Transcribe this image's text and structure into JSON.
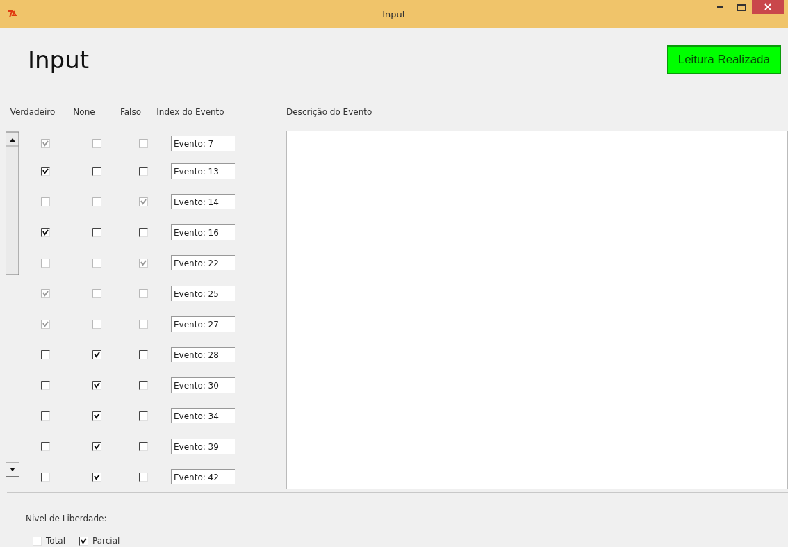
{
  "window": {
    "title": "Input"
  },
  "header": {
    "title": "Input",
    "status_button": "Leitura Realizada"
  },
  "table": {
    "columns": [
      "Verdadeiro",
      "None",
      "Falso",
      "Index do Evento",
      "Descrição do Evento"
    ],
    "rows": [
      {
        "verdadeiro": true,
        "none": false,
        "falso": false,
        "disabled": true,
        "index": "Evento: 7"
      },
      {
        "verdadeiro": true,
        "none": false,
        "falso": false,
        "disabled": false,
        "index": "Evento: 13"
      },
      {
        "verdadeiro": false,
        "none": false,
        "falso": true,
        "disabled": true,
        "index": "Evento: 14"
      },
      {
        "verdadeiro": true,
        "none": false,
        "falso": false,
        "disabled": false,
        "index": "Evento: 16"
      },
      {
        "verdadeiro": false,
        "none": false,
        "falso": true,
        "disabled": true,
        "index": "Evento: 22"
      },
      {
        "verdadeiro": true,
        "none": false,
        "falso": false,
        "disabled": true,
        "index": "Evento: 25"
      },
      {
        "verdadeiro": true,
        "none": false,
        "falso": false,
        "disabled": true,
        "index": "Evento: 27"
      },
      {
        "verdadeiro": false,
        "none": true,
        "falso": false,
        "disabled": false,
        "index": "Evento: 28"
      },
      {
        "verdadeiro": false,
        "none": true,
        "falso": false,
        "disabled": false,
        "index": "Evento: 30"
      },
      {
        "verdadeiro": false,
        "none": true,
        "falso": false,
        "disabled": false,
        "index": "Evento: 34"
      },
      {
        "verdadeiro": false,
        "none": true,
        "falso": false,
        "disabled": false,
        "index": "Evento: 39"
      },
      {
        "verdadeiro": false,
        "none": true,
        "falso": false,
        "disabled": false,
        "index": "Evento: 42"
      }
    ]
  },
  "freedom": {
    "label": "Nivel de Liberdade:",
    "options": [
      {
        "label": "Total",
        "checked": false
      },
      {
        "label": "Parcial",
        "checked": true
      }
    ]
  }
}
